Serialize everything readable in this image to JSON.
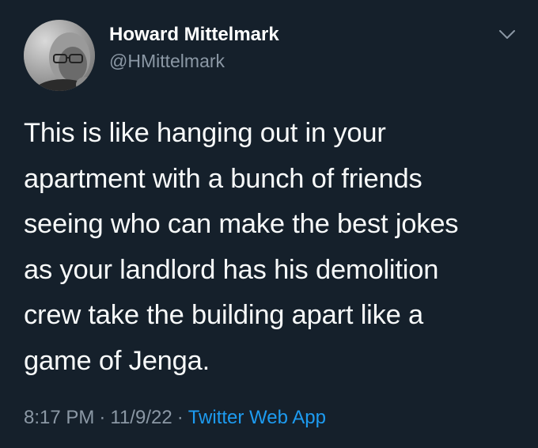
{
  "author": {
    "name": "Howard Mittelmark",
    "handle": "@HMittelmark",
    "avatar_icon": "profile-photo-grayscale"
  },
  "tweet": {
    "text": "This is like hanging out in your\napartment with a bunch of friends\nseeing who can make the best jokes\nas your landlord has his demolition\ncrew take the building apart like a\ngame of Jenga.",
    "time": "8:17 PM",
    "date": "11/9/22",
    "separator": "·",
    "source": "Twitter Web App"
  },
  "menu": {
    "icon": "chevron-down-icon"
  },
  "colors": {
    "background": "#15202b",
    "text": "#f7f9f9",
    "secondary": "#8b98a5",
    "link": "#1d9bf0"
  }
}
